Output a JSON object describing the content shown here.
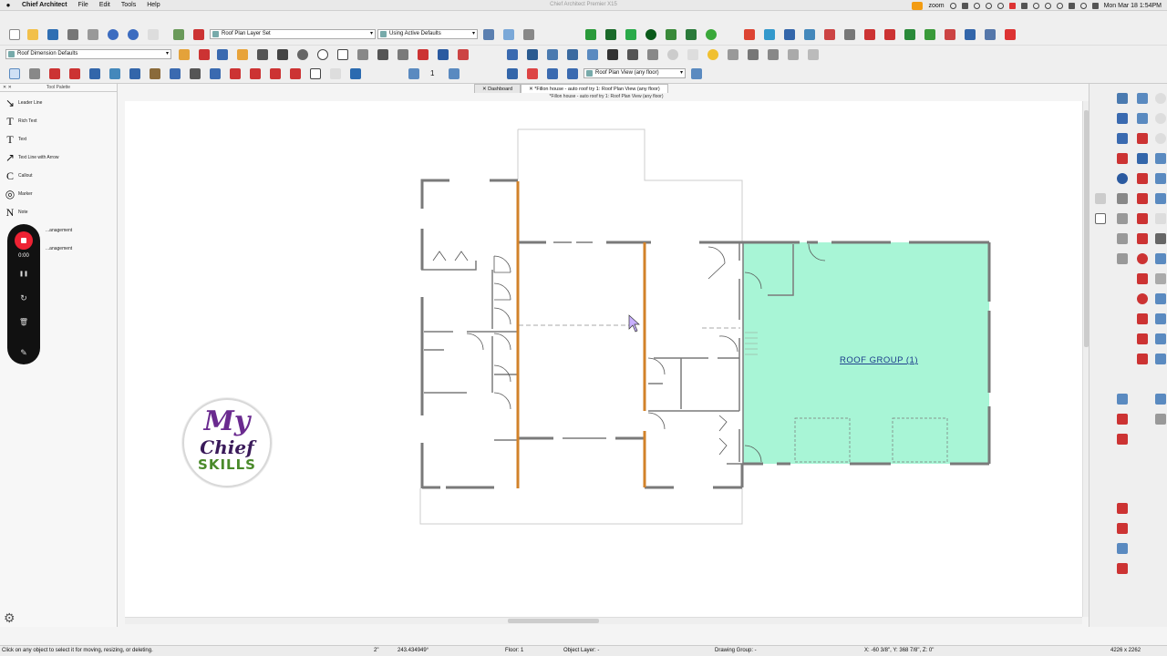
{
  "menubar": {
    "app_name": "Chief Architect",
    "items": [
      "File",
      "Edit",
      "Tools",
      "Help"
    ],
    "window_title": "Chief Architect Premier X15",
    "zoom_label": "zoom",
    "clock": "Mon Mar 18  1:54PM"
  },
  "toolbar": {
    "layer_set": "Roof Plan Layer Set",
    "defaults": "Using Active Defaults",
    "dimension_defaults": "Roof Dimension Defaults",
    "floor_number": "1",
    "view_select": "Roof Plan View (any floor)"
  },
  "palette": {
    "title": "Tool Palette",
    "items": [
      {
        "label": "Leader Line",
        "glyph": "↘"
      },
      {
        "label": "Rich Text",
        "glyph": "T"
      },
      {
        "label": "Text",
        "glyph": "T"
      },
      {
        "label": "Text Line with Arrow",
        "glyph": "↗"
      },
      {
        "label": "Callout",
        "glyph": "C"
      },
      {
        "label": "Marker",
        "glyph": "◎"
      },
      {
        "label": "Note",
        "glyph": "N"
      },
      {
        "label": "...anagement",
        "glyph": "▤"
      },
      {
        "label": "...anagement",
        "glyph": "▤"
      }
    ]
  },
  "recorder": {
    "time": "0:00",
    "pause_glyph": "❚❚",
    "restart_glyph": "↻",
    "delete_glyph": "🗑",
    "draw_glyph": "✎"
  },
  "tabs": [
    {
      "label": "Dashboard"
    },
    {
      "label": "*Fillon house - auto roof try 1:  Roof Plan View (any floor)"
    }
  ],
  "document_title": "*Fillon house - auto roof try 1:  Roof Plan View (any floor)",
  "plan": {
    "roof_label": "ROOF GROUP (1)",
    "roof_fill": "#a8f5d6",
    "bearing_wall_color": "#d2822a",
    "wall_color": "#7a7a7a"
  },
  "logo": {
    "line1": "My",
    "line2": "Chief",
    "line3": "SKILLS"
  },
  "status": {
    "hint": "Click on any object to select it for moving, resizing, or deleting.",
    "angle_unit": "2\"",
    "angle": "243.434949°",
    "floor": "Floor: 1",
    "object_layer": "Object Layer: -",
    "drawing_group": "Drawing Group: -",
    "coords": "X: -60 3/8\", Y: 368 7/8\", Z: 0\"",
    "resolution": "4226 x 2262"
  },
  "colors": {
    "accent_red": "#e22b33",
    "brand_purple": "#6a2a8f"
  }
}
